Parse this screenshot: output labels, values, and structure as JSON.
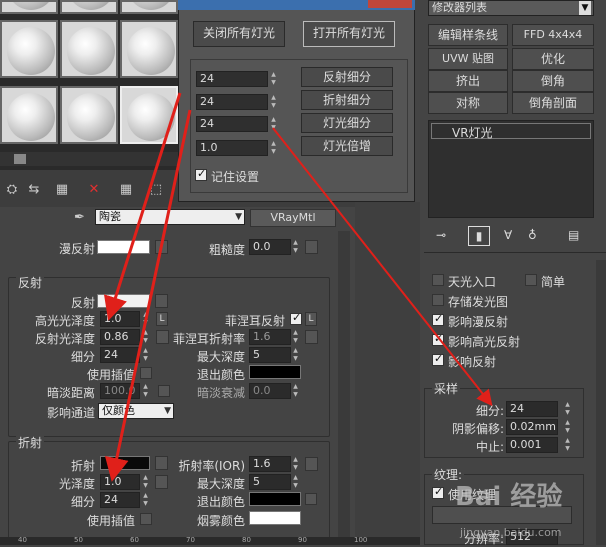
{
  "dialog": {
    "close_all_lights_label": "关闭所有灯光",
    "open_all_lights_label": "打开所有灯光",
    "rows": [
      {
        "value": "24",
        "label": "反射细分"
      },
      {
        "value": "24",
        "label": "折射细分"
      },
      {
        "value": "24",
        "label": "灯光细分"
      },
      {
        "value": "1.0",
        "label": "灯光倍增"
      }
    ],
    "remember_label": "记住设置"
  },
  "material": {
    "name": "陶瓷",
    "type": "VRayMtl",
    "diffuse_label": "漫反射",
    "roughness_label": "粗糙度",
    "roughness_value": "0.0",
    "diffuse_color": "#ffffff"
  },
  "reflection": {
    "title": "反射",
    "reflect_label": "反射",
    "hilight_gloss_label": "高光光泽度",
    "hilight_gloss_value": "1.0",
    "refl_gloss_label": "反射光泽度",
    "refl_gloss_value": "0.86",
    "subdivs_label": "细分",
    "subdivs_value": "24",
    "use_interp_label": "使用插值",
    "dim_distance_label": "暗淡距离",
    "dim_distance_value": "100.0",
    "affect_channels_label": "影响通道",
    "affect_channels_value": "仅颜色",
    "fresnel_label": "菲涅耳反射",
    "fresnel_ior_label": "菲涅耳折射率",
    "fresnel_ior_value": "1.6",
    "max_depth_label": "最大深度",
    "max_depth_value": "5",
    "exit_color_label": "退出颜色",
    "dim_falloff_label": "暗淡衰减",
    "dim_falloff_value": "0.0",
    "l_label": "L",
    "reflect_color": "#f2f2f2",
    "exit_color": "#000000"
  },
  "refraction": {
    "title": "折射",
    "refract_label": "折射",
    "gloss_label": "光泽度",
    "gloss_value": "1.0",
    "subdivs_label": "细分",
    "subdivs_value": "24",
    "use_interp_label": "使用插值",
    "ior_label": "折射率(IOR)",
    "ior_value": "1.6",
    "max_depth_label": "最大深度",
    "max_depth_value": "5",
    "exit_color_label": "退出颜色",
    "fog_color_label": "烟雾颜色",
    "refract_color": "#0a0a0a",
    "exit_color": "#000000",
    "fog_color": "#ffffff"
  },
  "command_panel": {
    "modifier_list": "修改器列表",
    "buttons": [
      "编辑样条线",
      "FFD 4x4x4",
      "UVW 贴图",
      "优化",
      "挤出",
      "倒角",
      "对称",
      "倒角剖面"
    ],
    "stack_item": "VR灯光",
    "options": {
      "skylight_portal": "天光入口",
      "simple": "简单",
      "store_irradiance": "存储发光图",
      "affect_diffuse": "影响漫反射",
      "affect_specular": "影响高光反射",
      "affect_reflections": "影响反射"
    },
    "sampling": {
      "title": "采样",
      "subdivs_label": "细分:",
      "subdivs_value": "24",
      "shadow_bias_label": "阴影偏移:",
      "shadow_bias_value": "0.02mm",
      "cutoff_label": "中止:",
      "cutoff_value": "0.001"
    },
    "texture": {
      "title": "纹理:",
      "use_texture_label": "使用纹理",
      "resolution_label": "分辨率:",
      "resolution_value": "512"
    }
  },
  "ruler_labels": [
    "40",
    "50",
    "60",
    "70",
    "80",
    "90",
    "100"
  ],
  "watermark": {
    "site": "jingyan.baidu.com",
    "brand": "Bai 经验"
  },
  "colors": {
    "arrow": "#e0201a",
    "dialog_title": "#3b6fae"
  }
}
